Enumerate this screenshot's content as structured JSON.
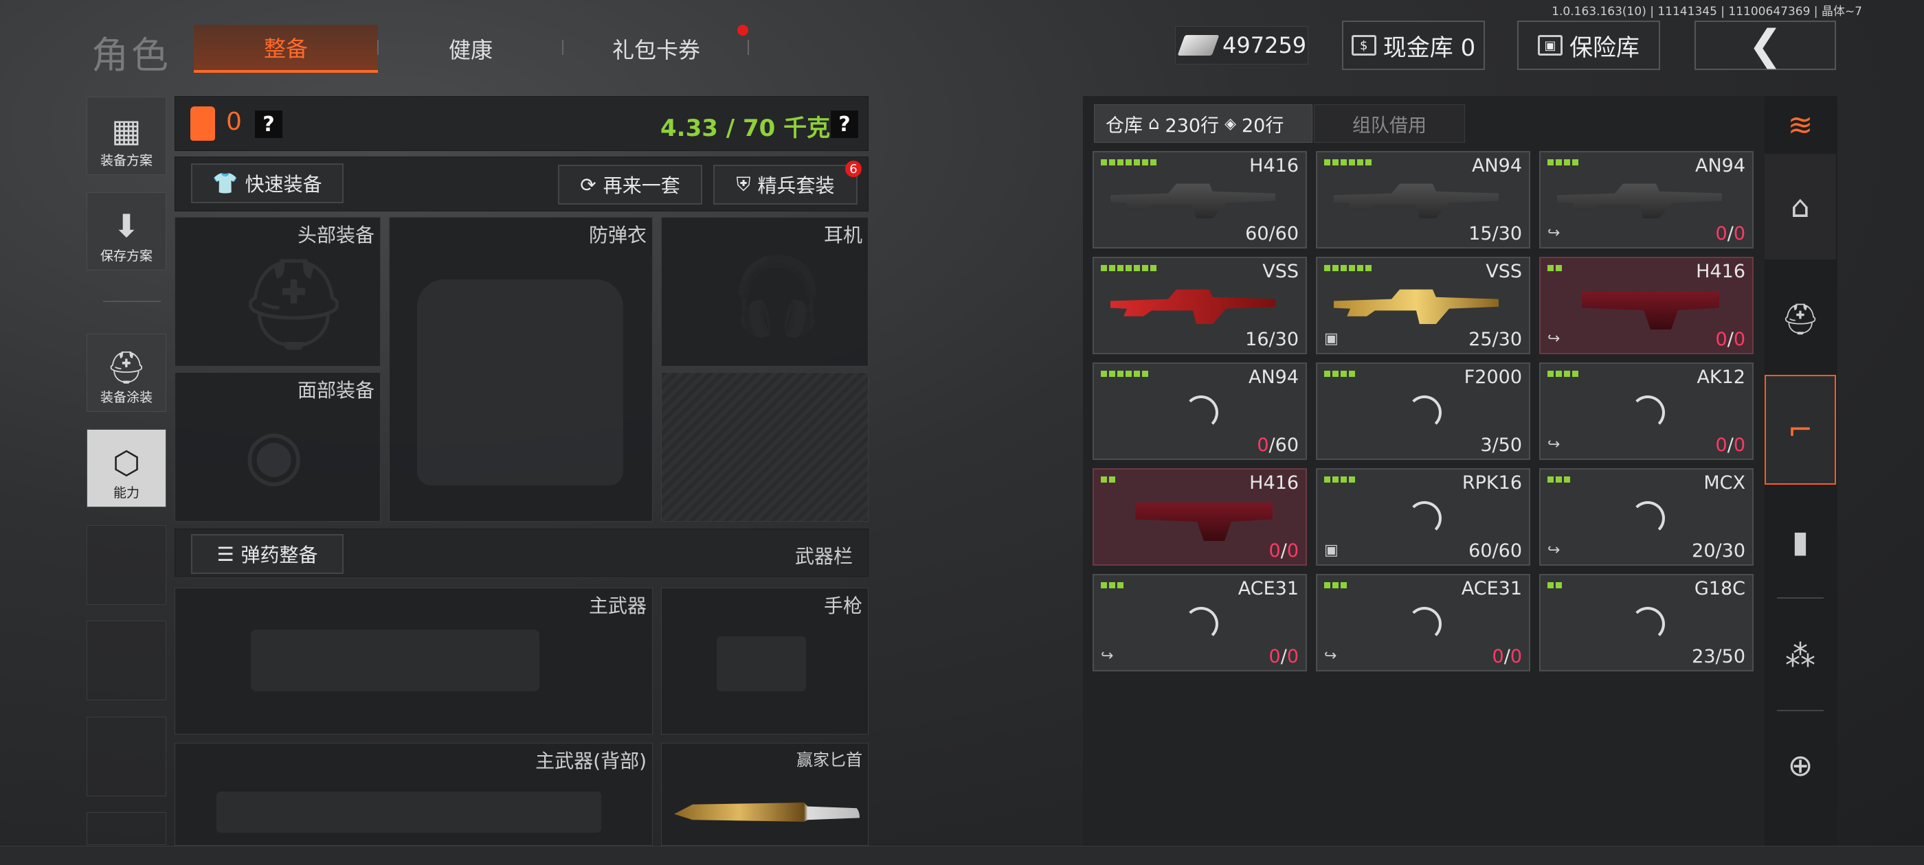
{
  "version_text": "1.0.163.163(10) | 11141345 | 11100647369 | 晶体~7",
  "header": {
    "title": "角色",
    "tabs": [
      {
        "label": "整备",
        "active": true
      },
      {
        "label": "健康",
        "active": false
      },
      {
        "label": "礼包卡券",
        "active": false,
        "notification_dot": true
      }
    ],
    "currency": {
      "icon": "cash-icon",
      "value": "497259"
    },
    "cash_vault_label": "现金库 0",
    "safe_box_label": "保险库",
    "back_icon": "back-arrow-icon"
  },
  "sidebar": {
    "items": [
      {
        "label": "装备方案",
        "icon": "vest-icon"
      },
      {
        "label": "保存方案",
        "icon": "download-icon"
      },
      {
        "label": "装备涂装",
        "icon": "helmet-paint-icon"
      },
      {
        "label": "能力",
        "icon": "ability-icon",
        "active": true
      }
    ]
  },
  "loadout": {
    "vest_count": "0",
    "help_q": "?",
    "weight": "4.33 / 70 千克",
    "weight_help": "?",
    "quick_equip_label": "快速装备",
    "again_label": "再来一套",
    "elite_label": "精兵套装",
    "elite_badge": "6",
    "slots": {
      "head": "头部装备",
      "armor": "防弹衣",
      "headset": "耳机",
      "face": "面部装备"
    },
    "ammo_label": "弹药整备",
    "weapon_bar_label": "武器栏",
    "primary": "主武器",
    "pistol": "手枪",
    "primary_back": "主武器(背部)",
    "knife": "赢家匕首"
  },
  "warehouse": {
    "tab_label": "仓库",
    "rows_a": "230行",
    "rows_b": "20行",
    "team_tab": "组队借用",
    "items": [
      {
        "name": "H416",
        "cur": "60",
        "max": "60",
        "bars": 7,
        "red": false,
        "loaded": true,
        "zero": false,
        "exit": false
      },
      {
        "name": "AN94",
        "cur": "15",
        "max": "30",
        "bars": 6,
        "red": false,
        "loaded": true,
        "zero": false,
        "exit": false
      },
      {
        "name": "AN94",
        "cur": "0",
        "max": "0",
        "bars": 4,
        "red": false,
        "loaded": true,
        "zero": true,
        "exit": true
      },
      {
        "name": "VSS",
        "cur": "16",
        "max": "30",
        "bars": 7,
        "red": false,
        "loaded": true,
        "zero": false,
        "exit": false,
        "skin": "red"
      },
      {
        "name": "VSS",
        "cur": "25",
        "max": "30",
        "bars": 6,
        "red": false,
        "loaded": true,
        "zero": false,
        "exit": false,
        "skin": "gold",
        "box": true
      },
      {
        "name": "H416",
        "cur": "0",
        "max": "0",
        "bars": 2,
        "red": true,
        "loaded": true,
        "zero": true,
        "exit": true,
        "lower": true
      },
      {
        "name": "AN94",
        "cur": "0",
        "max": "60",
        "bars": 6,
        "red": false,
        "loaded": false,
        "zero": "cur",
        "exit": false
      },
      {
        "name": "F2000",
        "cur": "3",
        "max": "50",
        "bars": 4,
        "red": false,
        "loaded": false,
        "zero": false,
        "exit": false
      },
      {
        "name": "AK12",
        "cur": "0",
        "max": "0",
        "bars": 4,
        "red": false,
        "loaded": false,
        "zero": true,
        "exit": true
      },
      {
        "name": "H416",
        "cur": "0",
        "max": "0",
        "bars": 2,
        "red": true,
        "loaded": true,
        "zero": true,
        "exit": false,
        "lower": true
      },
      {
        "name": "RPK16",
        "cur": "60",
        "max": "60",
        "bars": 4,
        "red": false,
        "loaded": false,
        "zero": false,
        "exit": false,
        "box": true
      },
      {
        "name": "MCX",
        "cur": "20",
        "max": "30",
        "bars": 3,
        "red": false,
        "loaded": false,
        "zero": false,
        "exit": true
      },
      {
        "name": "ACE31",
        "cur": "0",
        "max": "0",
        "bars": 3,
        "red": false,
        "loaded": false,
        "zero": true,
        "exit": true
      },
      {
        "name": "ACE31",
        "cur": "0",
        "max": "0",
        "bars": 3,
        "red": false,
        "loaded": false,
        "zero": true,
        "exit": true
      },
      {
        "name": "G18C",
        "cur": "23",
        "max": "50",
        "bars": 2,
        "red": false,
        "loaded": false,
        "zero": false,
        "exit": false
      }
    ]
  },
  "right_sidebar": [
    {
      "icon": "stack-refresh-icon",
      "active": false
    },
    {
      "icon": "home-icon",
      "active": false
    },
    {
      "icon": "helmet-icon",
      "active": false
    },
    {
      "icon": "gun-icon",
      "active": true
    },
    {
      "icon": "magazine-icon",
      "active": false
    },
    {
      "icon": "bullet-icon",
      "active": false
    },
    {
      "icon": "scope-icon",
      "active": false
    }
  ]
}
